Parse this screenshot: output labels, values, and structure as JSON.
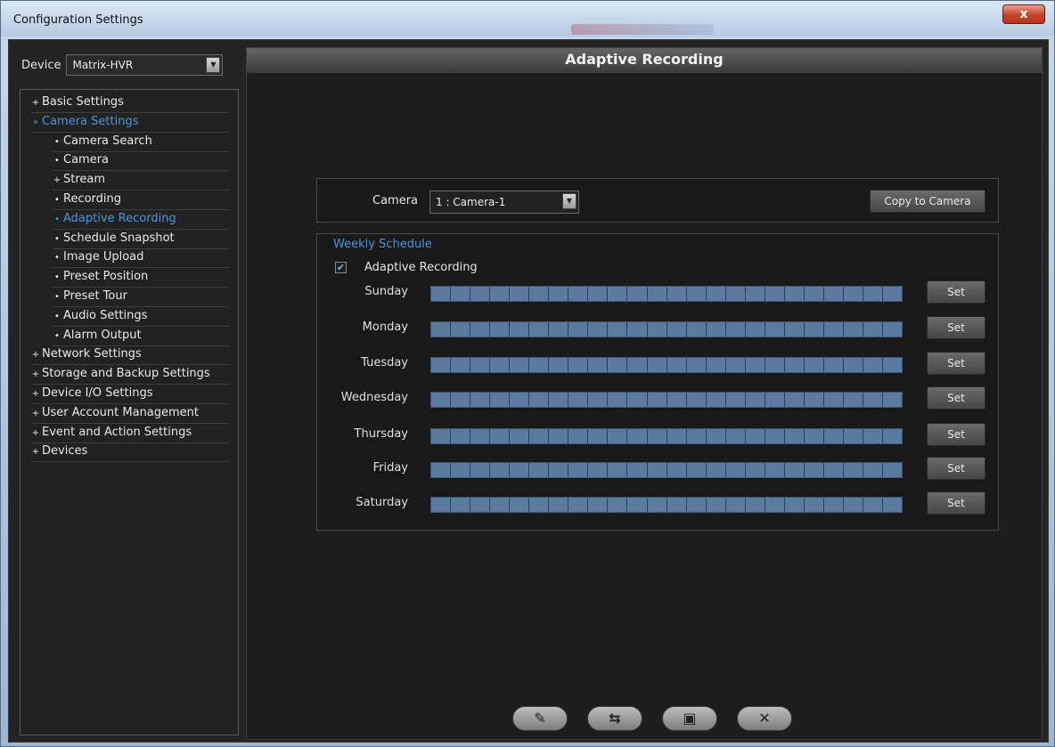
{
  "window": {
    "title": "Configuration Settings",
    "close_glyph": "x"
  },
  "sidebar": {
    "device_label": "Device",
    "device_value": "Matrix-HVR",
    "tree": [
      {
        "label": "Basic Settings",
        "bullet": "+",
        "level": 0,
        "active": false
      },
      {
        "label": "Camera Settings",
        "bullet": "»",
        "level": 0,
        "active": true
      },
      {
        "label": "Camera Search",
        "bullet": "•",
        "level": 1,
        "active": false
      },
      {
        "label": "Camera",
        "bullet": "•",
        "level": 1,
        "active": false
      },
      {
        "label": "Stream",
        "bullet": "+",
        "level": 1,
        "active": false
      },
      {
        "label": "Recording",
        "bullet": "•",
        "level": 1,
        "active": false
      },
      {
        "label": "Adaptive Recording",
        "bullet": "•",
        "level": 1,
        "active": true
      },
      {
        "label": "Schedule Snapshot",
        "bullet": "•",
        "level": 1,
        "active": false
      },
      {
        "label": "Image Upload",
        "bullet": "•",
        "level": 1,
        "active": false
      },
      {
        "label": "Preset Position",
        "bullet": "•",
        "level": 1,
        "active": false
      },
      {
        "label": "Preset Tour",
        "bullet": "•",
        "level": 1,
        "active": false
      },
      {
        "label": "Audio Settings",
        "bullet": "•",
        "level": 1,
        "active": false
      },
      {
        "label": "Alarm Output",
        "bullet": "•",
        "level": 1,
        "active": false
      },
      {
        "label": "Network Settings",
        "bullet": "+",
        "level": 0,
        "active": false
      },
      {
        "label": "Storage and Backup Settings",
        "bullet": "+",
        "level": 0,
        "active": false
      },
      {
        "label": "Device I/O Settings",
        "bullet": "+",
        "level": 0,
        "active": false
      },
      {
        "label": "User Account Management",
        "bullet": "+",
        "level": 0,
        "active": false
      },
      {
        "label": "Event and Action Settings",
        "bullet": "+",
        "level": 0,
        "active": false
      },
      {
        "label": "Devices",
        "bullet": "+",
        "level": 0,
        "active": false
      }
    ]
  },
  "main": {
    "header": "Adaptive Recording",
    "camera_label": "Camera",
    "camera_value": "1 : Camera-1",
    "copy_button": "Copy to Camera",
    "schedule_heading": "Weekly Schedule",
    "adaptive_checkbox": {
      "label": "Adaptive Recording",
      "checked": true
    },
    "set_label": "Set",
    "days": [
      "Sunday",
      "Monday",
      "Tuesday",
      "Wednesday",
      "Thursday",
      "Friday",
      "Saturday"
    ],
    "hours_per_day": 24,
    "bar_color": "#5b7aa0"
  },
  "footer_icons": [
    "check-edit-icon",
    "refresh-icon",
    "save-icon",
    "close-icon"
  ],
  "colors": {
    "accent": "#4c96d8",
    "panel_bg": "#1d1d1d"
  }
}
